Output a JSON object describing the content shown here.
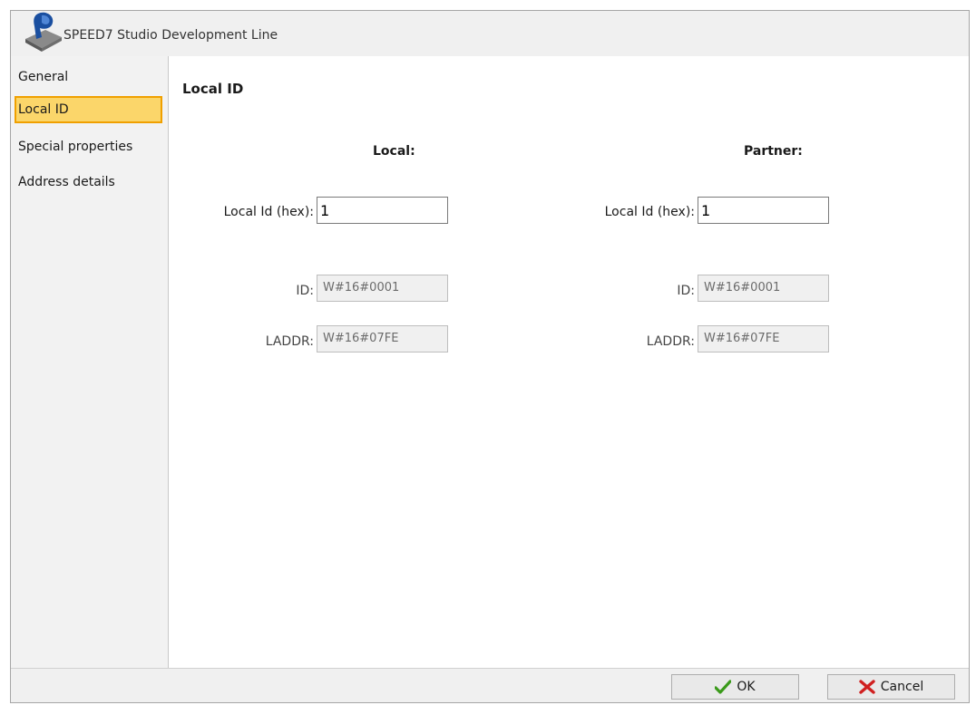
{
  "window": {
    "title": "SPEED7 Studio Development Line",
    "icon": "speed7-app-icon"
  },
  "sidebar": {
    "items": [
      {
        "label": "General",
        "selected": false
      },
      {
        "label": "Local ID",
        "selected": true
      },
      {
        "label": "Special properties",
        "selected": false
      },
      {
        "label": "Address details",
        "selected": false
      }
    ]
  },
  "main": {
    "section_title": "Local ID",
    "local": {
      "heading": "Local:",
      "local_id_label": "Local Id (hex):",
      "local_id_value": "1",
      "id_label": "ID:",
      "id_value": "W#16#0001",
      "laddr_label": "LADDR:",
      "laddr_value": "W#16#07FE"
    },
    "partner": {
      "heading": "Partner:",
      "local_id_label": "Local Id (hex):",
      "local_id_value": "1",
      "id_label": "ID:",
      "id_value": "W#16#0001",
      "laddr_label": "LADDR:",
      "laddr_value": "W#16#07FE"
    }
  },
  "footer": {
    "ok_label": "OK",
    "ok_icon": "checkmark-icon",
    "cancel_label": "Cancel",
    "cancel_icon": "x-icon"
  },
  "colors": {
    "selected_bg": "#fbd66a",
    "selected_border": "#f0a000",
    "ok_check": "#3a9a1a",
    "cancel_x": "#d02020"
  }
}
